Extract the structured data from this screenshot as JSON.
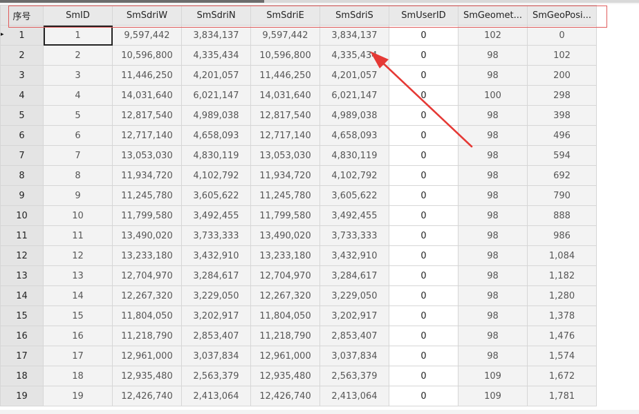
{
  "table": {
    "columns": [
      "序号",
      "SmID",
      "SmSdriW",
      "SmSdriN",
      "SmSdriE",
      "SmSdriS",
      "SmUserID",
      "SmGeomet...",
      "SmGeoPosi..."
    ],
    "rows": [
      [
        "1",
        "1",
        "9,597,442",
        "3,834,137",
        "9,597,442",
        "3,834,137",
        "0",
        "102",
        "0"
      ],
      [
        "2",
        "2",
        "10,596,800",
        "4,335,434",
        "10,596,800",
        "4,335,434",
        "0",
        "98",
        "102"
      ],
      [
        "3",
        "3",
        "11,446,250",
        "4,201,057",
        "11,446,250",
        "4,201,057",
        "0",
        "98",
        "200"
      ],
      [
        "4",
        "4",
        "14,031,640",
        "6,021,147",
        "14,031,640",
        "6,021,147",
        "0",
        "100",
        "298"
      ],
      [
        "5",
        "5",
        "12,817,540",
        "4,989,038",
        "12,817,540",
        "4,989,038",
        "0",
        "98",
        "398"
      ],
      [
        "6",
        "6",
        "12,717,140",
        "4,658,093",
        "12,717,140",
        "4,658,093",
        "0",
        "98",
        "496"
      ],
      [
        "7",
        "7",
        "13,053,030",
        "4,830,119",
        "13,053,030",
        "4,830,119",
        "0",
        "98",
        "594"
      ],
      [
        "8",
        "8",
        "11,934,720",
        "4,102,792",
        "11,934,720",
        "4,102,792",
        "0",
        "98",
        "692"
      ],
      [
        "9",
        "9",
        "11,245,780",
        "3,605,622",
        "11,245,780",
        "3,605,622",
        "0",
        "98",
        "790"
      ],
      [
        "10",
        "10",
        "11,799,580",
        "3,492,455",
        "11,799,580",
        "3,492,455",
        "0",
        "98",
        "888"
      ],
      [
        "11",
        "11",
        "13,490,020",
        "3,733,333",
        "13,490,020",
        "3,733,333",
        "0",
        "98",
        "986"
      ],
      [
        "12",
        "12",
        "13,233,180",
        "3,432,910",
        "13,233,180",
        "3,432,910",
        "0",
        "98",
        "1,084"
      ],
      [
        "13",
        "13",
        "12,704,970",
        "3,284,617",
        "12,704,970",
        "3,284,617",
        "0",
        "98",
        "1,182"
      ],
      [
        "14",
        "14",
        "12,267,320",
        "3,229,050",
        "12,267,320",
        "3,229,050",
        "0",
        "98",
        "1,280"
      ],
      [
        "15",
        "15",
        "11,804,050",
        "3,202,917",
        "11,804,050",
        "3,202,917",
        "0",
        "98",
        "1,378"
      ],
      [
        "16",
        "16",
        "11,218,790",
        "2,853,407",
        "11,218,790",
        "2,853,407",
        "0",
        "98",
        "1,476"
      ],
      [
        "17",
        "17",
        "12,961,000",
        "3,037,834",
        "12,961,000",
        "3,037,834",
        "0",
        "98",
        "1,574"
      ],
      [
        "18",
        "18",
        "12,935,480",
        "2,563,379",
        "12,935,480",
        "2,563,379",
        "0",
        "109",
        "1,672"
      ],
      [
        "19",
        "19",
        "12,426,740",
        "2,413,064",
        "12,426,740",
        "2,413,064",
        "0",
        "109",
        "1,781"
      ]
    ]
  },
  "current_row_marker": "▸",
  "colors": {
    "annotation": "#e53935",
    "header_bg": "#e9e9e9",
    "readonly_cell_bg": "#f3f3f3"
  }
}
